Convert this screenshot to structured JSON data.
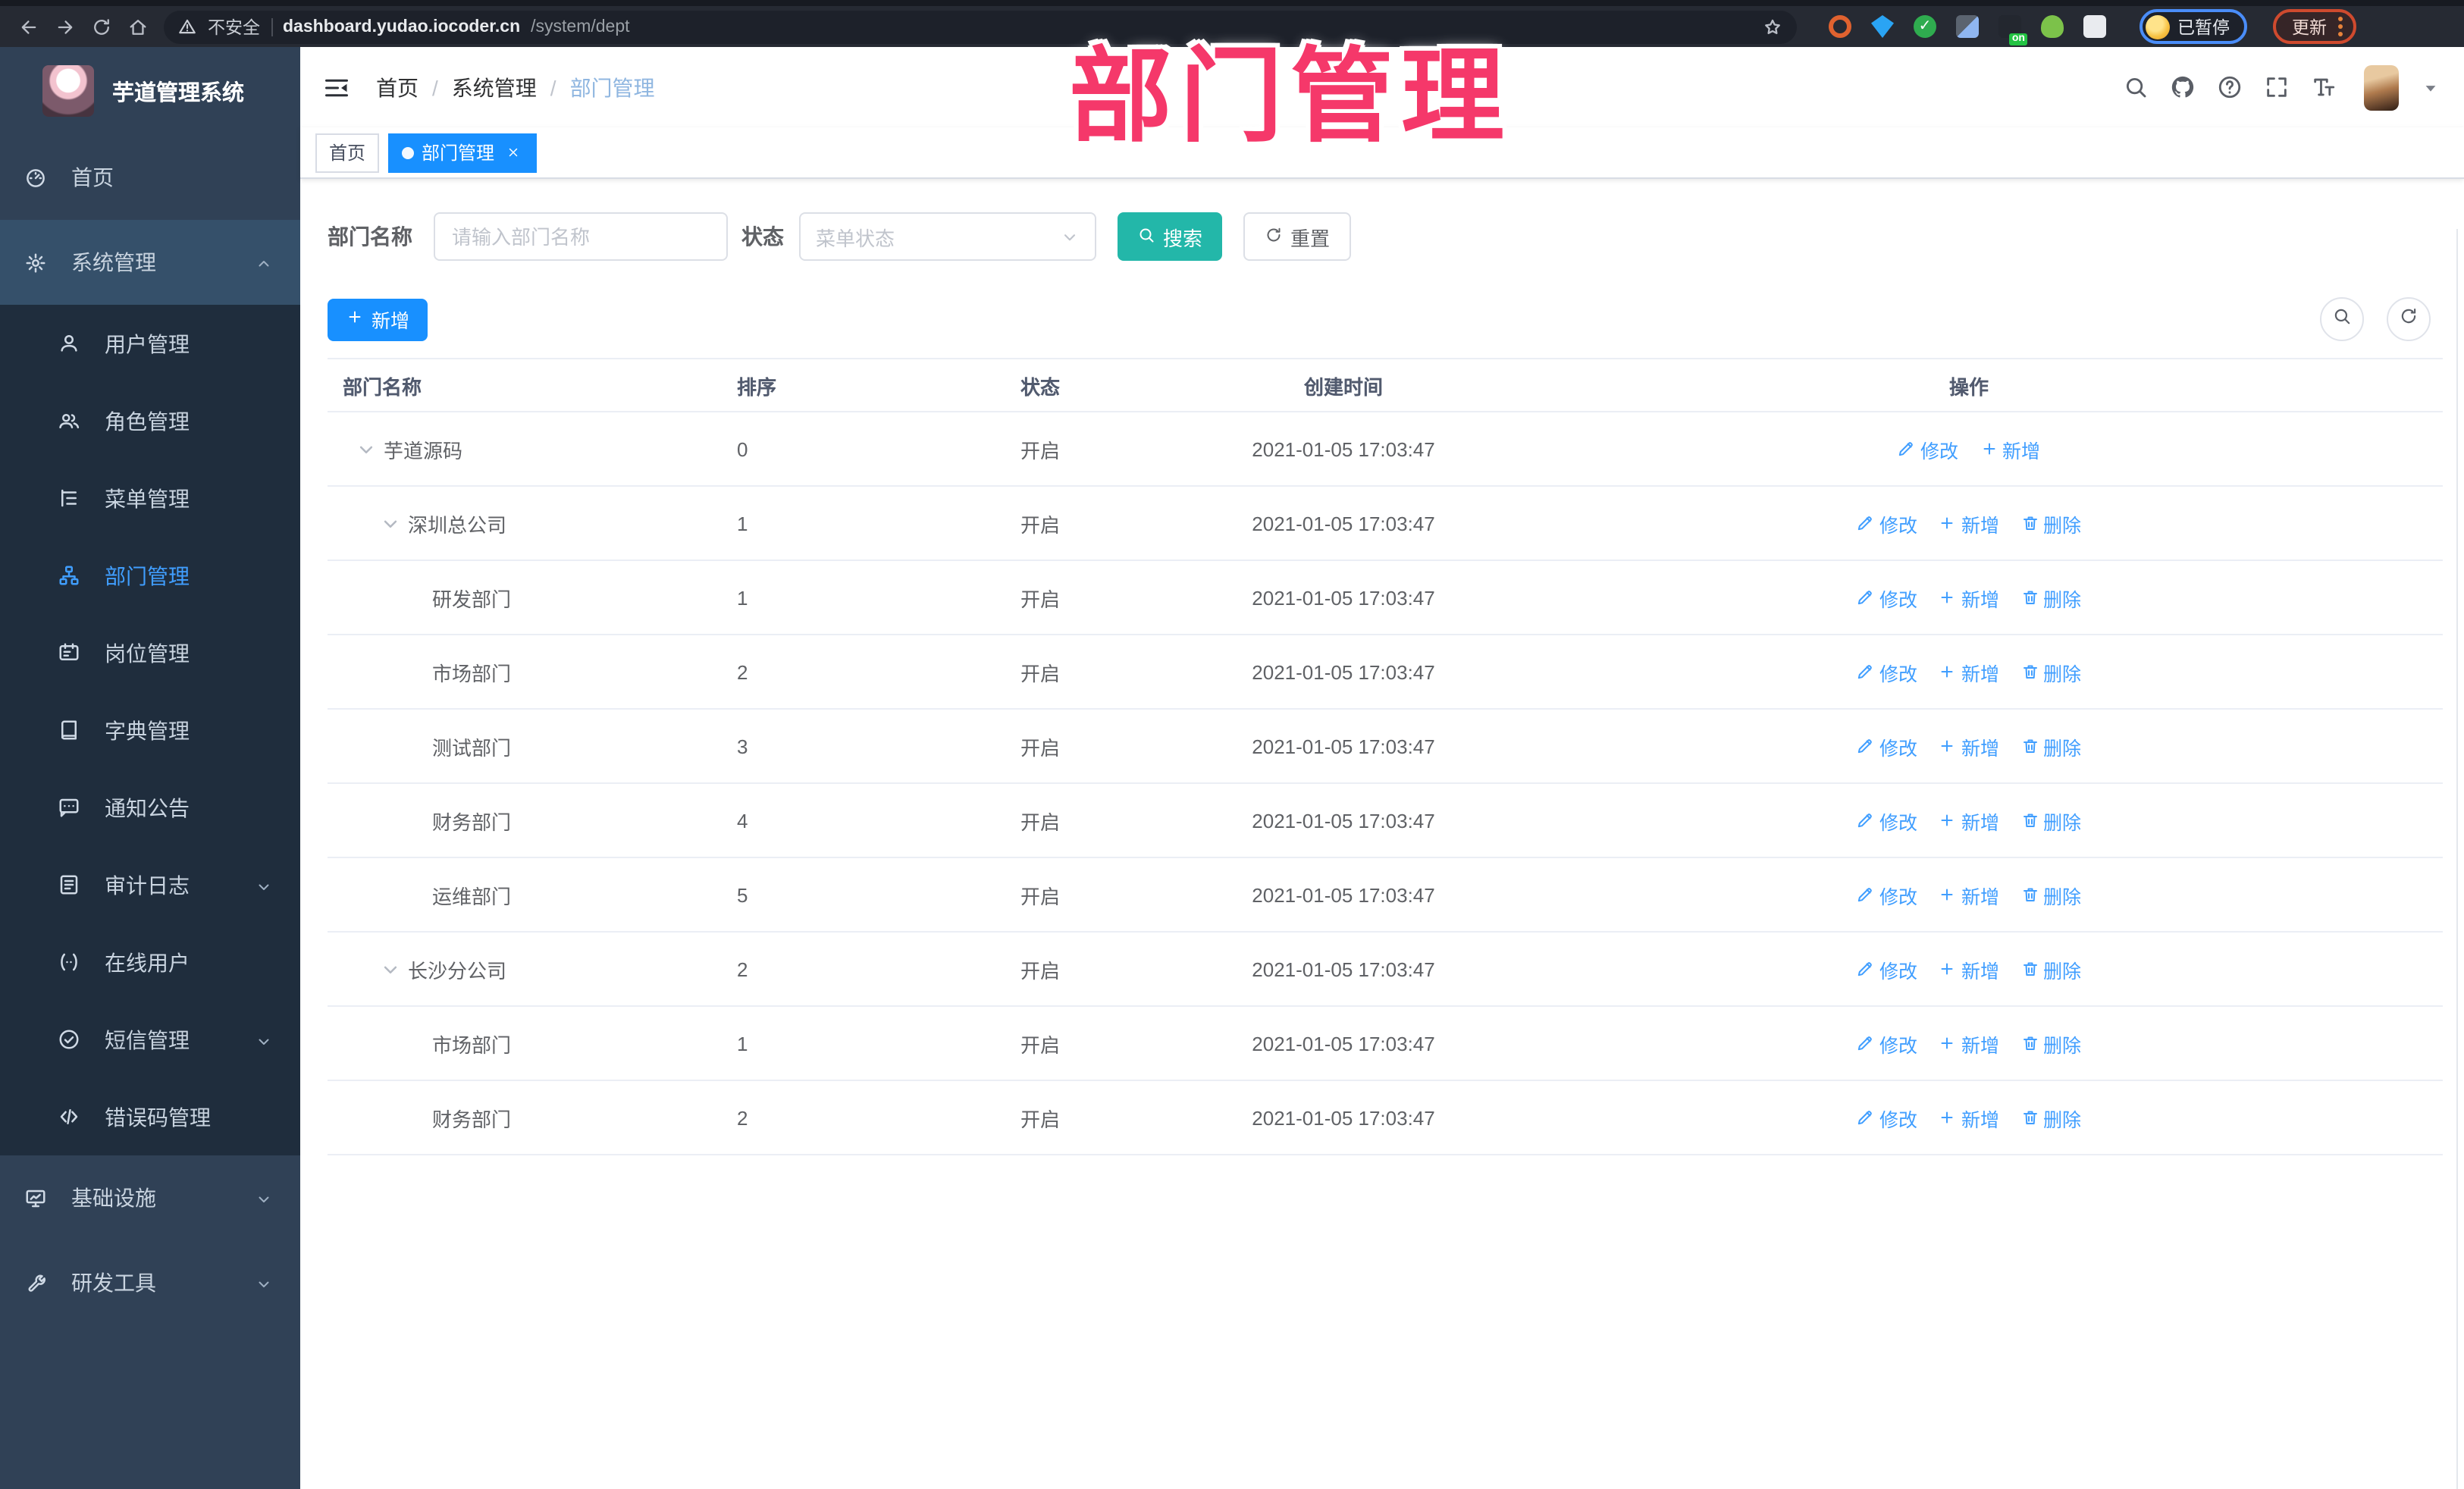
{
  "annotation": {
    "text": "部门管理",
    "color": "#f5386a"
  },
  "browser": {
    "nav_icons": [
      "back-icon",
      "forward-icon",
      "reload-icon",
      "home-icon"
    ],
    "security_warning": "不安全",
    "url_host": "dashboard.yudao.iocoder.cn",
    "url_path": "/system/dept",
    "bookmark_icon": "star-icon",
    "extensions": [
      {
        "kind": "ring",
        "name": "extension-ring-icon",
        "color": "#e0622f"
      },
      {
        "kind": "gem",
        "name": "extension-gem-icon",
        "color": "#2aa4f4"
      },
      {
        "kind": "check",
        "name": "extension-check-icon",
        "color": "#2fac4f",
        "glyph": "✓"
      },
      {
        "kind": "grid",
        "name": "extension-grid-icon",
        "color": "#8fb6f0"
      },
      {
        "kind": "console",
        "name": "extension-console-icon",
        "color": "#23272f",
        "badge": "on",
        "badge_color": "#23c343"
      },
      {
        "kind": "person",
        "name": "extension-person-icon",
        "color": "#7cc24a"
      },
      {
        "kind": "puzzle",
        "name": "extension-puzzle-icon",
        "color": "#e9ebef"
      }
    ],
    "profile_chip": {
      "status": "已暂停",
      "border_color": "#4a8df8"
    },
    "update_chip": {
      "label": "更新",
      "border_color": "#cf4a2e"
    }
  },
  "sidebar": {
    "logo_title": "芋道管理系统",
    "colors": {
      "bg": "#304156",
      "submenu_bg": "#1f2d3d",
      "active": "#409eff",
      "text": "#c9d4e0"
    },
    "items": [
      {
        "label": "首页",
        "icon": "dashboard-icon",
        "type": "root"
      },
      {
        "label": "系统管理",
        "icon": "component-icon",
        "type": "root-open",
        "chevron": "up",
        "expanded": true
      },
      {
        "label": "用户管理",
        "icon": "user-icon",
        "type": "sub"
      },
      {
        "label": "角色管理",
        "icon": "peoples-icon",
        "type": "sub"
      },
      {
        "label": "菜单管理",
        "icon": "tree-table-icon",
        "type": "sub"
      },
      {
        "label": "部门管理",
        "icon": "tree-icon",
        "type": "sub",
        "active": true
      },
      {
        "label": "岗位管理",
        "icon": "post-icon",
        "type": "sub"
      },
      {
        "label": "字典管理",
        "icon": "dict-icon",
        "type": "sub"
      },
      {
        "label": "通知公告",
        "icon": "message-icon",
        "type": "sub"
      },
      {
        "label": "审计日志",
        "icon": "log-icon",
        "type": "sub",
        "chevron": "down"
      },
      {
        "label": "在线用户",
        "icon": "online-icon",
        "type": "sub"
      },
      {
        "label": "短信管理",
        "icon": "sms-icon",
        "type": "sub",
        "chevron": "down"
      },
      {
        "label": "错误码管理",
        "icon": "code-icon",
        "type": "sub"
      },
      {
        "label": "基础设施",
        "icon": "monitor-icon",
        "type": "root",
        "chevron": "down"
      },
      {
        "label": "研发工具",
        "icon": "tool-icon",
        "type": "root",
        "chevron": "down"
      }
    ]
  },
  "navbar": {
    "breadcrumb": [
      "首页",
      "系统管理",
      "部门管理"
    ],
    "right_icons": [
      "search-icon",
      "github-icon",
      "question-icon",
      "fullscreen-icon",
      "font-size-icon"
    ]
  },
  "tags": [
    {
      "label": "首页",
      "active": false
    },
    {
      "label": "部门管理",
      "active": true,
      "closable": true
    }
  ],
  "filter": {
    "dept_label": "部门名称",
    "dept_placeholder": "请输入部门名称",
    "dept_value": "",
    "status_label": "状态",
    "status_placeholder": "菜单状态",
    "search_label": "搜索",
    "reset_label": "重置"
  },
  "toolbar": {
    "add_label": "新增"
  },
  "table": {
    "columns": [
      "部门名称",
      "排序",
      "状态",
      "创建时间",
      "操作"
    ],
    "action_labels": {
      "edit": "修改",
      "add": "新增",
      "delete": "删除"
    },
    "rows": [
      {
        "name": "芋道源码",
        "level": 0,
        "expandable": true,
        "sort": "0",
        "status": "开启",
        "created": "2021-01-05 17:03:47",
        "actions": [
          "edit",
          "add"
        ]
      },
      {
        "name": "深圳总公司",
        "level": 1,
        "expandable": true,
        "sort": "1",
        "status": "开启",
        "created": "2021-01-05 17:03:47",
        "actions": [
          "edit",
          "add",
          "delete"
        ]
      },
      {
        "name": "研发部门",
        "level": 2,
        "expandable": false,
        "sort": "1",
        "status": "开启",
        "created": "2021-01-05 17:03:47",
        "actions": [
          "edit",
          "add",
          "delete"
        ]
      },
      {
        "name": "市场部门",
        "level": 2,
        "expandable": false,
        "sort": "2",
        "status": "开启",
        "created": "2021-01-05 17:03:47",
        "actions": [
          "edit",
          "add",
          "delete"
        ]
      },
      {
        "name": "测试部门",
        "level": 2,
        "expandable": false,
        "sort": "3",
        "status": "开启",
        "created": "2021-01-05 17:03:47",
        "actions": [
          "edit",
          "add",
          "delete"
        ]
      },
      {
        "name": "财务部门",
        "level": 2,
        "expandable": false,
        "sort": "4",
        "status": "开启",
        "created": "2021-01-05 17:03:47",
        "actions": [
          "edit",
          "add",
          "delete"
        ]
      },
      {
        "name": "运维部门",
        "level": 2,
        "expandable": false,
        "sort": "5",
        "status": "开启",
        "created": "2021-01-05 17:03:47",
        "actions": [
          "edit",
          "add",
          "delete"
        ]
      },
      {
        "name": "长沙分公司",
        "level": 1,
        "expandable": true,
        "sort": "2",
        "status": "开启",
        "created": "2021-01-05 17:03:47",
        "actions": [
          "edit",
          "add",
          "delete"
        ]
      },
      {
        "name": "市场部门",
        "level": 2,
        "expandable": false,
        "sort": "1",
        "status": "开启",
        "created": "2021-01-05 17:03:47",
        "actions": [
          "edit",
          "add",
          "delete"
        ]
      },
      {
        "name": "财务部门",
        "level": 2,
        "expandable": false,
        "sort": "2",
        "status": "开启",
        "created": "2021-01-05 17:03:47",
        "actions": [
          "edit",
          "add",
          "delete"
        ]
      }
    ]
  },
  "colors": {
    "primary_blue": "#1890ff",
    "link_blue": "#409eff",
    "search_teal": "#23b7a9",
    "tag_active_blue": "#1890ff",
    "annotation_pink": "#f5386a",
    "sidebar_bg": "#304156",
    "submenu_bg": "#1f2d3d"
  }
}
